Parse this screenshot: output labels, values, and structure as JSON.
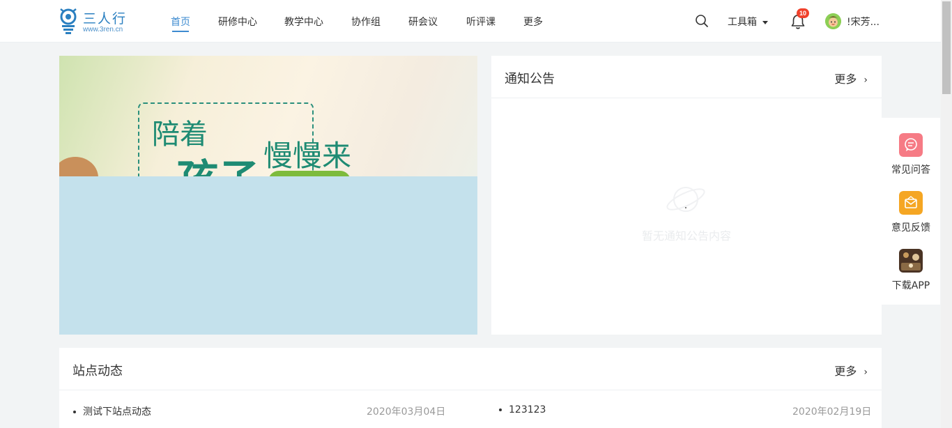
{
  "header": {
    "logo": {
      "name": "三人行",
      "url": "www.3ren.cn"
    },
    "nav": [
      {
        "label": "首页",
        "active": true
      },
      {
        "label": "研修中心"
      },
      {
        "label": "教学中心"
      },
      {
        "label": "协作组"
      },
      {
        "label": "研会议"
      },
      {
        "label": "听评课"
      },
      {
        "label": "更多"
      }
    ],
    "toolbox_label": "工具箱",
    "notification_count": "10",
    "username": "!宋芳..."
  },
  "banner": {
    "line1": "陪着",
    "line2": "慢慢来",
    "line3": "孩子"
  },
  "notice": {
    "title": "通知公告",
    "more": "更多",
    "empty_text": "暂无通知公告内容"
  },
  "side_panel": [
    {
      "label": "常见问答",
      "icon": "faq-icon",
      "color": "#f67b85"
    },
    {
      "label": "意见反馈",
      "icon": "feedback-icon",
      "color": "#f5a623"
    },
    {
      "label": "下载APP",
      "icon": "app-thumbnail"
    }
  ],
  "site_news": {
    "title": "站点动态",
    "more": "更多",
    "items": [
      {
        "title": "测试下站点动态",
        "date": "2020年03月04日"
      },
      {
        "title": "123123",
        "date": "2020年02月19日"
      }
    ]
  },
  "colors": {
    "accent": "#3d8bd0",
    "badge": "#f0412b",
    "page_bg": "#f2f4f5",
    "banner_bg": "#c4e1ec"
  }
}
